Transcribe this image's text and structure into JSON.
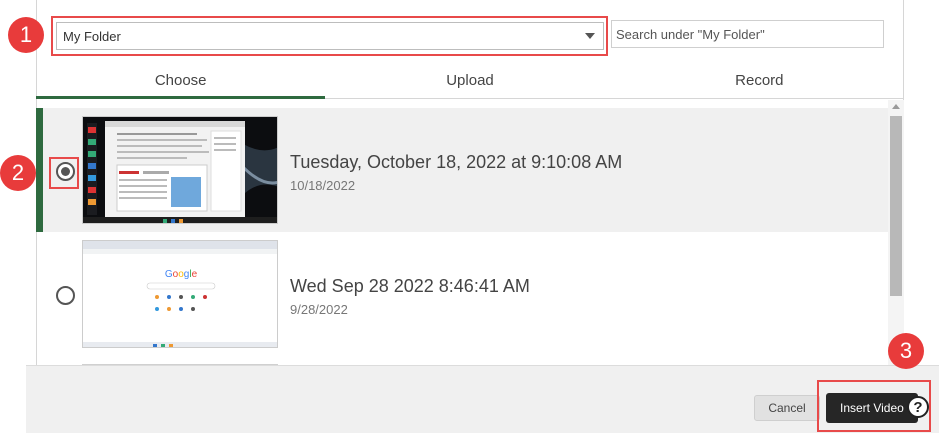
{
  "folder": {
    "value": "My Folder"
  },
  "search": {
    "placeholder": "Search under \"My Folder\""
  },
  "tabs": [
    {
      "label": "Choose",
      "active": true
    },
    {
      "label": "Upload",
      "active": false
    },
    {
      "label": "Record",
      "active": false
    }
  ],
  "videos": [
    {
      "title": "Tuesday, October 18, 2022 at 9:10:08 AM",
      "date": "10/18/2022",
      "selected": true
    },
    {
      "title": "Wed Sep 28 2022 8:46:41 AM",
      "date": "9/28/2022",
      "selected": false
    }
  ],
  "footer": {
    "cancel_label": "Cancel",
    "insert_label": "Insert Video",
    "help_symbol": "?"
  },
  "callouts": [
    "1",
    "2",
    "3"
  ],
  "colors": {
    "accent": "#2e6a3f",
    "callout": "#e83b3b",
    "primary_button": "#262626"
  }
}
